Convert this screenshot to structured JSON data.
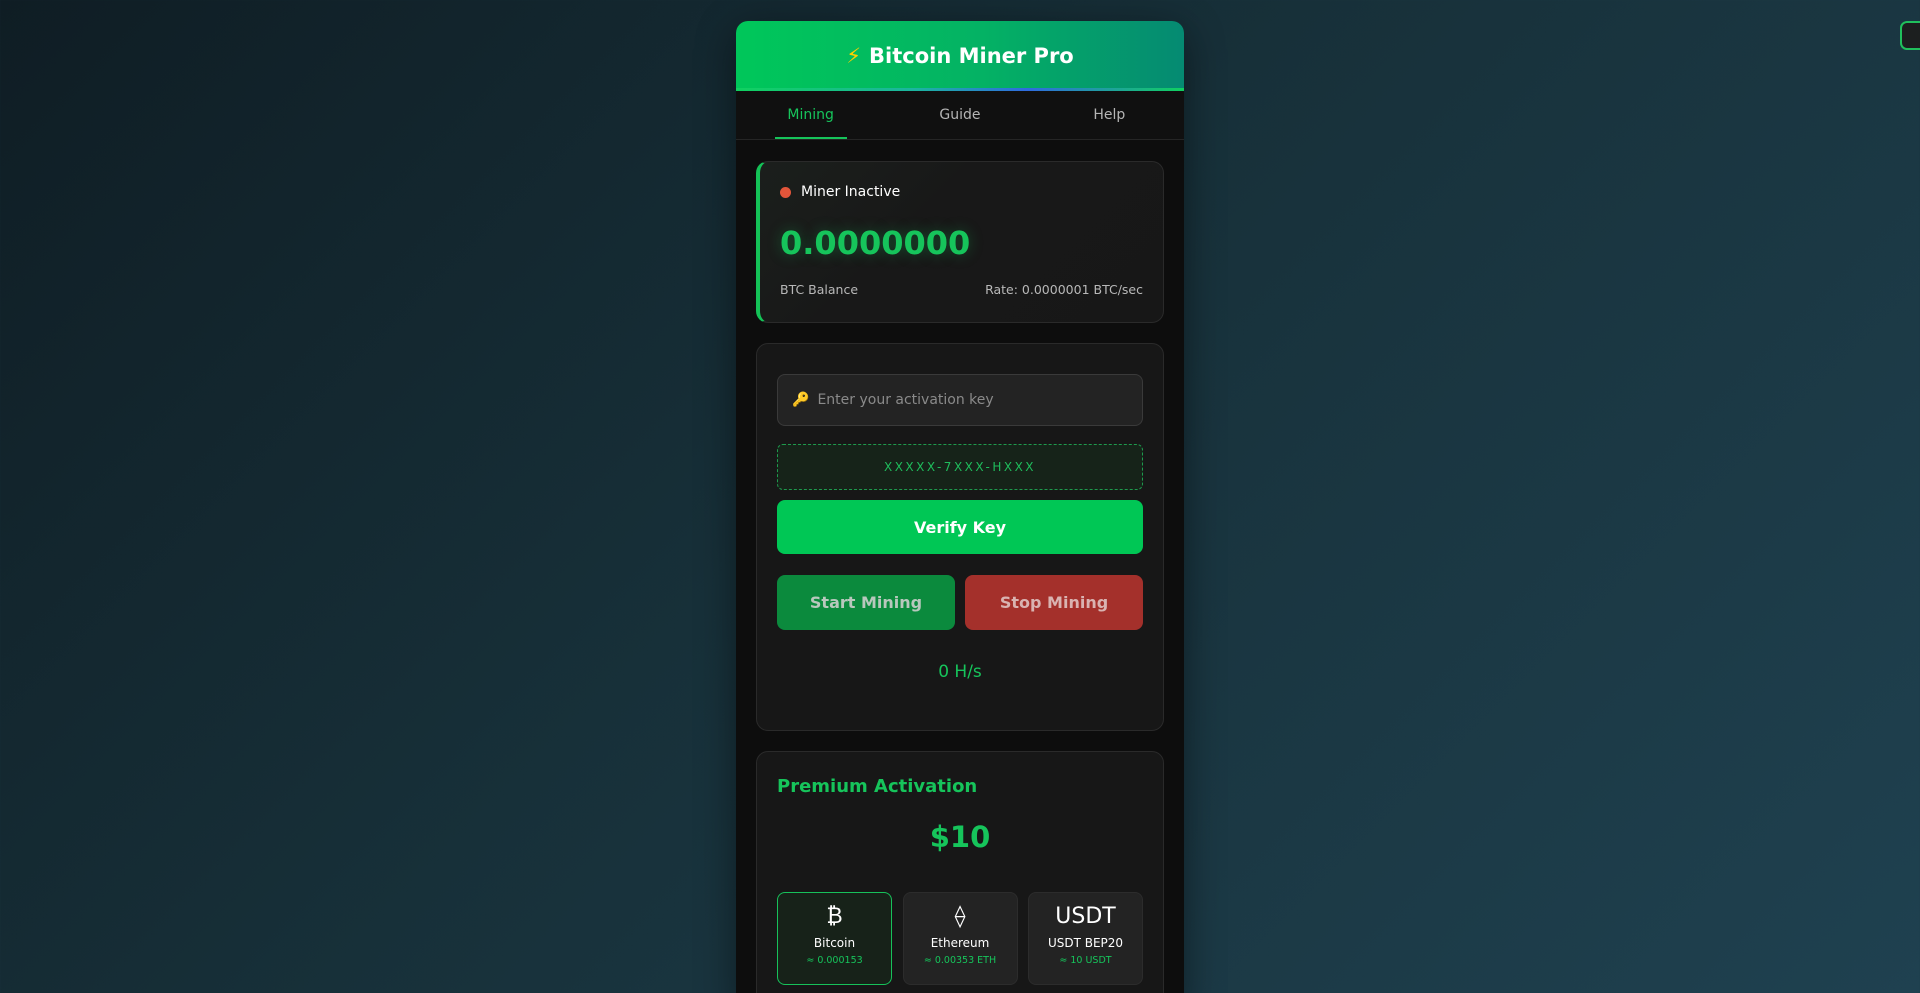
{
  "header": {
    "bolt_icon": "⚡",
    "title": "Bitcoin Miner Pro"
  },
  "tabs": [
    {
      "label": "Mining",
      "active": true
    },
    {
      "label": "Guide",
      "active": false
    },
    {
      "label": "Help",
      "active": false
    }
  ],
  "status": {
    "label": "Miner Inactive",
    "dot_color": "#e2553a",
    "balance": "0.0000000",
    "balance_label": "BTC Balance",
    "rate": "Rate: 0.0000001 BTC/sec"
  },
  "activation": {
    "key_icon": "🔑",
    "placeholder": "Enter your activation key",
    "format_hint": "XXXXX-7XXX-HXXX",
    "verify_label": "Verify Key",
    "start_label": "Start Mining",
    "stop_label": "Stop Mining",
    "hashrate": "0 H/s"
  },
  "premium": {
    "title": "Premium Activation",
    "price": "$10",
    "coins": [
      {
        "symbol": "₿",
        "name": "Bitcoin",
        "amount": "≈ 0.000153",
        "selected": true
      },
      {
        "symbol": "⟠",
        "name": "Ethereum",
        "amount": "≈ 0.00353 ETH",
        "selected": false
      },
      {
        "symbol": "USDT",
        "name": "USDT BEP20",
        "amount": "≈ 10 USDT",
        "selected": false
      }
    ]
  },
  "colors": {
    "accent": "#16c45b",
    "danger": "#a4302b",
    "background": "#0d0d0d"
  }
}
